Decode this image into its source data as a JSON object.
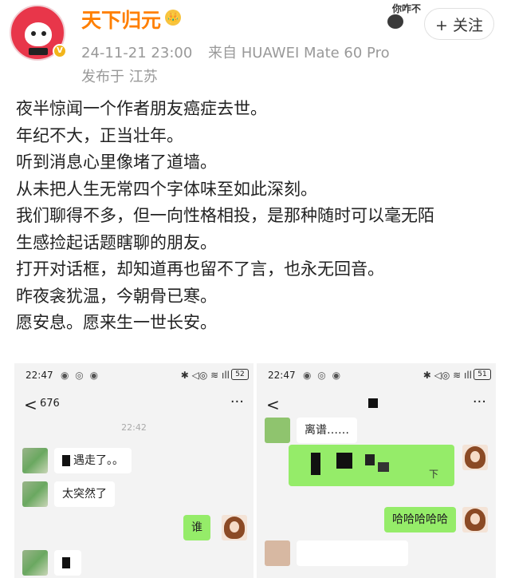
{
  "header": {
    "username": "天下归元",
    "crown_icon": "👑",
    "verified_icon": "V",
    "timestamp": "24-11-21 23:00",
    "source": "来自 HUAWEI Mate 60 Pro",
    "location": "发布于 江苏",
    "sticker_text": "你咋不上",
    "follow_label": "+ 关注"
  },
  "post": {
    "lines": [
      "夜半惊闻一个作者朋友癌症去世。",
      "年纪不大，正当壮年。",
      "听到消息心里像堵了道墙。",
      "从未把人生无常四个字体味至如此深刻。",
      "我们聊得不多，但一向性格相投，是那种随时可以毫无陌",
      "生感捡起话题瞎聊的朋友。",
      "打开对话框，却知道再也留不了言，也永无回音。",
      "昨夜衾犹温，今朝骨已寒。",
      "愿安息。愿来生一世长安。"
    ]
  },
  "screenshot_left": {
    "time": "22:47",
    "app_icons": "◉ ◎ ◉",
    "status_icons": "✱ ◁◎ ≋ ıll",
    "battery": "52",
    "back_icon": "<",
    "unread_count": "676",
    "more_icon": "···",
    "chat_time": "22:42",
    "messages": {
      "m1": "遇走了。。",
      "m2": "太突然了",
      "m3": "谁"
    }
  },
  "screenshot_right": {
    "time": "22:47",
    "app_icons": "◉ ◎ ◉",
    "status_icons": "✱ ◁◎ ≋ ıll",
    "battery": "51",
    "back_icon": "<",
    "more_icon": "···",
    "messages": {
      "m1": "离谱……",
      "m2_suffix": "下",
      "m3": "哈哈哈哈哈"
    }
  }
}
